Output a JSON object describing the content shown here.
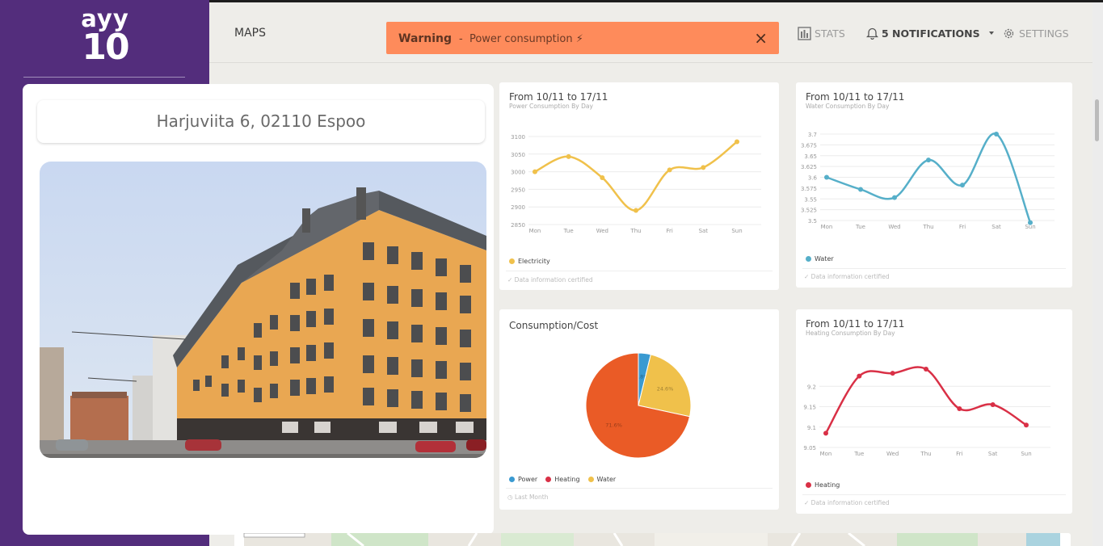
{
  "app": {
    "logo_line1": "ayy",
    "logo_line2": "10"
  },
  "nav": {
    "maps": "MAPS",
    "stats": "STATS",
    "notifications": "5 NOTIFICATIONS",
    "settings": "SETTINGS",
    "icons": {
      "stats": "bar-chart-icon",
      "notifications": "bell-icon",
      "settings": "gear-icon",
      "dropdown": "caret-down-icon"
    }
  },
  "warning": {
    "title": "Warning",
    "separator": "-",
    "message": "Power consumption ⚡",
    "close": "×",
    "color": "#fe8b5b"
  },
  "property": {
    "address": "Harjuviita 6, 02110 Espoo"
  },
  "colors": {
    "sidebar": "#532d7c",
    "electricity": "#f0c14b",
    "water": "#56afc9",
    "heating": "#d93046",
    "pie_heating": "#ea5b26",
    "pie_power": "#3a9ad1"
  },
  "charts": {
    "power": {
      "title": "From 10/11 to 17/11",
      "subtitle": "Power Consumption By Day",
      "legend": "Electricity",
      "footer": "Data information certified",
      "footer_icon": "check-icon"
    },
    "water": {
      "title": "From 10/11 to 17/11",
      "subtitle": "Water Consumption By Day",
      "legend": "Water",
      "footer": "Data information certified",
      "footer_icon": "check-icon"
    },
    "cost": {
      "title": "Consumption/Cost",
      "legend": [
        "Power",
        "Heating",
        "Water"
      ],
      "footer": "Last Month",
      "footer_icon": "clock-icon"
    },
    "heating": {
      "title": "From 10/11 to 17/11",
      "subtitle": "Heating Consumption By Day",
      "legend": "Heating",
      "footer": "Data information certified",
      "footer_icon": "check-icon"
    }
  },
  "chart_data": [
    {
      "type": "line",
      "title": "From 10/11 to 17/11",
      "subtitle": "Power Consumption By Day",
      "categories": [
        "Mon",
        "Tue",
        "Wed",
        "Thu",
        "Fri",
        "Sat",
        "Sun"
      ],
      "series": [
        {
          "name": "Electricity",
          "values": [
            3000,
            3043,
            2983,
            2890,
            3005,
            3012,
            3085
          ]
        }
      ],
      "yticks": [
        3100,
        3050,
        3000,
        2950,
        2900,
        2850
      ],
      "ylim": [
        2850,
        3100
      ],
      "legend_position": "bottom-left",
      "grid": true
    },
    {
      "type": "line",
      "title": "From 10/11 to 17/11",
      "subtitle": "Water Consumption By Day",
      "categories": [
        "Mon",
        "Tue",
        "Wed",
        "Thu",
        "Fri",
        "Sat",
        "Sun"
      ],
      "series": [
        {
          "name": "Water",
          "values": [
            3.6,
            3.572,
            3.553,
            3.64,
            3.582,
            3.7,
            3.495
          ]
        }
      ],
      "yticks": [
        3.7,
        3.675,
        3.65,
        3.625,
        3.6,
        3.575,
        3.55,
        3.525,
        3.5
      ],
      "ylim": [
        3.5,
        3.7
      ],
      "legend_position": "bottom-left",
      "grid": true
    },
    {
      "type": "pie",
      "title": "Consumption/Cost",
      "slices": [
        {
          "name": "Power",
          "value": 3.8,
          "label": "3.8%"
        },
        {
          "name": "Water",
          "value": 24.6,
          "label": "24.6%"
        },
        {
          "name": "Heating",
          "value": 71.6,
          "label": "71.6%"
        }
      ],
      "legend_position": "bottom-left"
    },
    {
      "type": "line",
      "title": "From 10/11 to 17/11",
      "subtitle": "Heating Consumption By Day",
      "categories": [
        "Mon",
        "Tue",
        "Wed",
        "Thu",
        "Fri",
        "Sat",
        "Sun"
      ],
      "series": [
        {
          "name": "Heating",
          "values": [
            9.085,
            9.225,
            9.232,
            9.242,
            9.145,
            9.155,
            9.105
          ]
        }
      ],
      "yticks": [
        9.2,
        9.15,
        9.1,
        9.05
      ],
      "ylim": [
        9.05,
        9.25
      ],
      "legend_position": "bottom-left",
      "grid": true
    }
  ]
}
